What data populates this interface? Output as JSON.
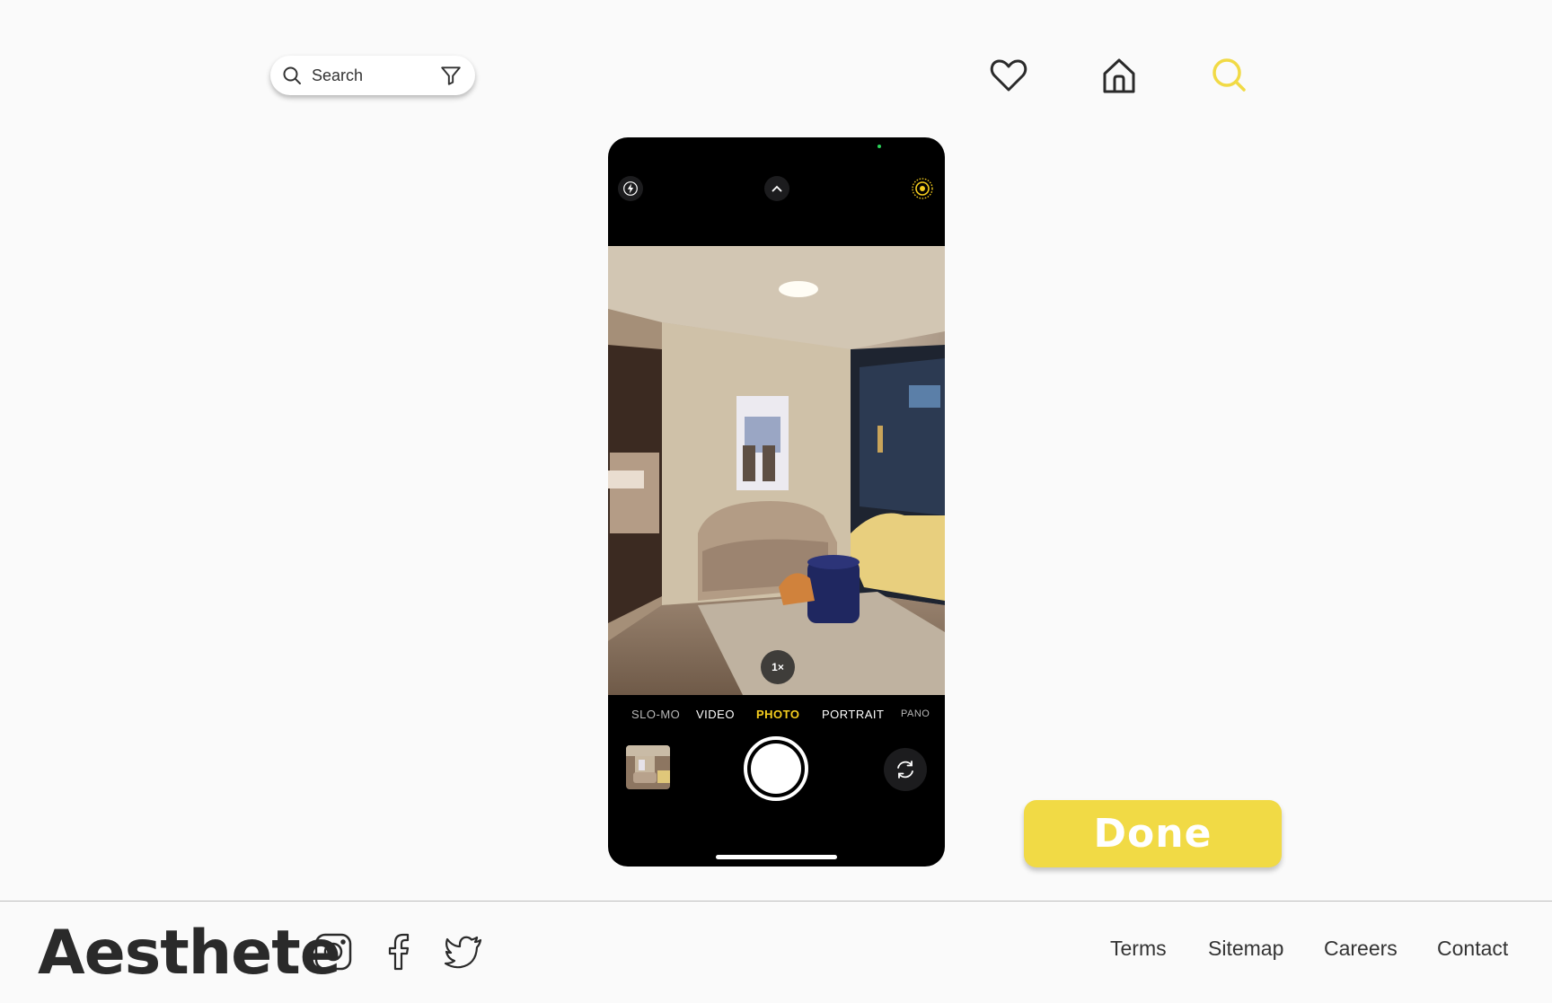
{
  "search": {
    "placeholder": "Search",
    "search_icon": "search-icon",
    "filter_icon": "filter-icon"
  },
  "nav": {
    "icons": [
      "heart-icon",
      "home-icon",
      "search-icon"
    ],
    "active_color": "#f1da45"
  },
  "camera": {
    "top_controls": [
      "flash-icon",
      "chevron-up-icon",
      "live-photo-icon"
    ],
    "zoom": "1×",
    "modes": [
      "SLO-MO",
      "VIDEO",
      "PHOTO",
      "PORTRAIT",
      "PANO"
    ],
    "active_mode": "PHOTO",
    "accent_color": "#f5cd1e"
  },
  "done_button": {
    "label": "Done",
    "color": "#f1da45"
  },
  "footer": {
    "brand": "Aesthete",
    "social": [
      "instagram-icon",
      "facebook-icon",
      "twitter-icon"
    ],
    "links": [
      "Terms",
      "Sitemap",
      "Careers",
      "Contact"
    ]
  }
}
